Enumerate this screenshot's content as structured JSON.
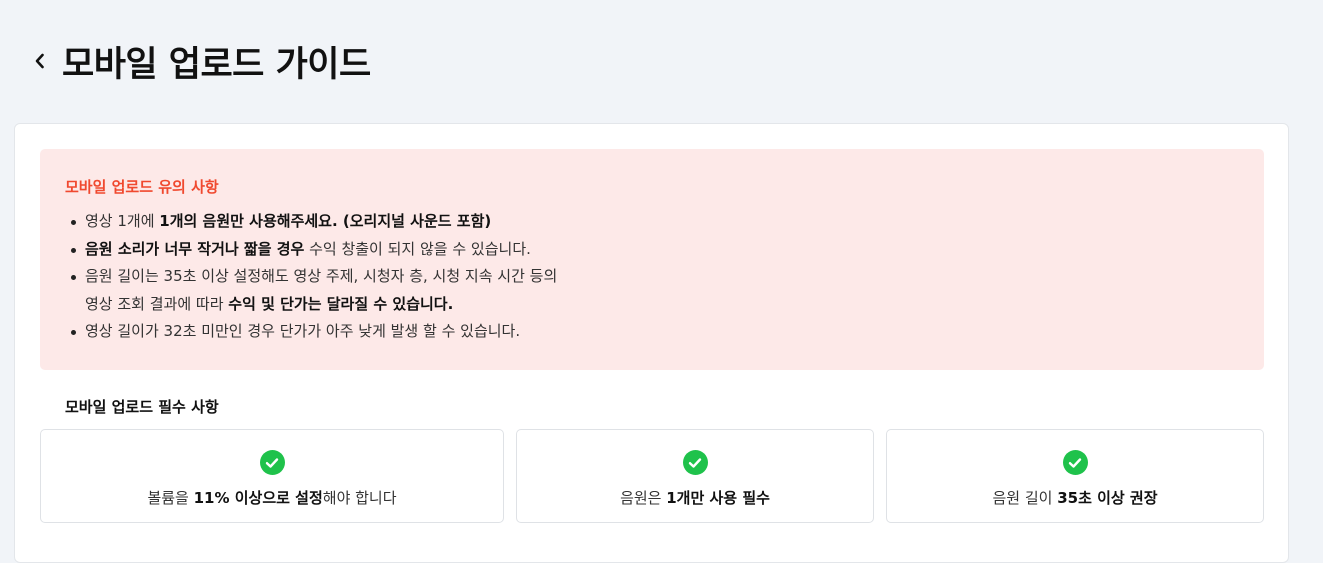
{
  "header": {
    "title": "모바일 업로드 가이드"
  },
  "notice": {
    "title": "모바일 업로드 유의 사항",
    "items": [
      {
        "pre": "영상 1개에 ",
        "bold": "1개의 음원만 사용해주세요. (오리지널 사운드 포함)",
        "post": ""
      },
      {
        "pre": "",
        "bold": "음원 소리가 너무 작거나 짧을 경우",
        "post": " 수익 창출이 되지 않을 수 있습니다."
      },
      {
        "pre": "음원 길이는 35초 이상 설정해도 영상 주제, 시청자 층, 시청 지속 시간 등의",
        "pre2": "영상 조회 결과에 따라 ",
        "bold": "수익 및 단가는 달라질 수 있습니다.",
        "post": ""
      },
      {
        "pre": "영상 길이가 32초 미만인 경우 단가가 아주 낮게 발생 할 수 있습니다.",
        "bold": "",
        "post": ""
      }
    ]
  },
  "requirements": {
    "title": "모바일 업로드 필수 사항",
    "cards": [
      {
        "icon": "check-circle-icon",
        "pre": "볼륨을 ",
        "bold": "11% 이상으로 설정",
        "post": "해야 합니다"
      },
      {
        "icon": "check-circle-icon",
        "pre": "음원은 ",
        "bold": "1개만 사용 필수",
        "post": ""
      },
      {
        "icon": "check-circle-icon",
        "pre": "음원 길이 ",
        "bold": "35초 이상 권장",
        "post": ""
      }
    ]
  },
  "colors": {
    "notice_title": "#f0492f",
    "notice_bg": "#fde9e8",
    "check": "#1fc24b",
    "page_bg": "#f1f4f8"
  }
}
